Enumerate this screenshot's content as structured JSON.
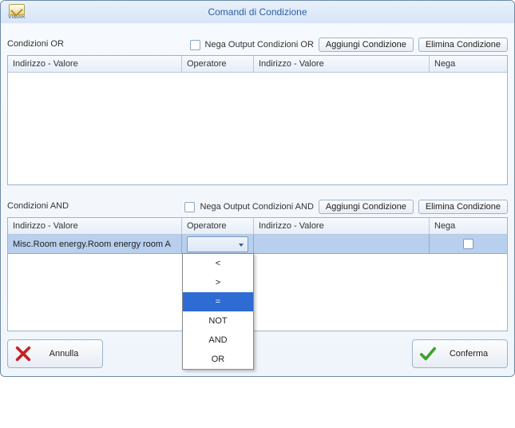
{
  "window": {
    "title": "Comandi di Condizione",
    "logo_label": "VIMAR"
  },
  "or": {
    "title": "Condizioni OR",
    "neg_label": "Nega Output Condizioni OR",
    "add_label": "Aggiungi Condizione",
    "del_label": "Elimina Condizione",
    "headers": {
      "c1": "Indirizzo - Valore",
      "c2": "Operatore",
      "c3": "Indirizzo - Valore",
      "c4": "Nega"
    }
  },
  "and": {
    "title": "Condizioni AND",
    "neg_label": "Nega Output Condizioni AND",
    "add_label": "Aggiungi Condizione",
    "del_label": "Elimina Condizione",
    "headers": {
      "c1": "Indirizzo - Valore",
      "c2": "Operatore",
      "c3": "Indirizzo - Valore",
      "c4": "Nega"
    },
    "rows": [
      {
        "addr1": "Misc.Room energy.Room energy room A",
        "op": "",
        "addr2": "",
        "neg": false
      }
    ]
  },
  "operator_options": [
    "<",
    ">",
    "=",
    "NOT",
    "AND",
    "OR"
  ],
  "operator_selected_index": 2,
  "footer": {
    "cancel": "Annulla",
    "confirm": "Conferma"
  }
}
